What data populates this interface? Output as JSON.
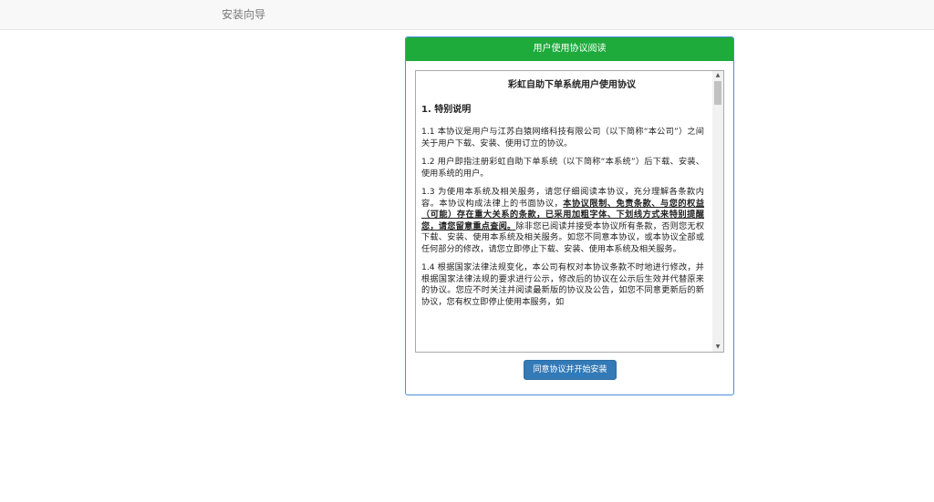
{
  "navbar": {
    "brand": "安装向导"
  },
  "panel": {
    "heading": "用户使用协议阅读",
    "install_button": "同意协议并开始安装"
  },
  "agreement": {
    "title": "彩虹自助下单系统用户使用协议",
    "section1_title": "1. 特别说明",
    "p1_1": "1.1 本协议是用户与江苏白猿网络科技有限公司（以下简称“本公司”）之间关于用户下载、安装、使用订立的协议。",
    "p1_2": "1.2 用户即指注册彩虹自助下单系统（以下简称“本系统”）后下载、安装、使用系统的用户。",
    "p1_3_a": "1.3 为使用本系统及相关服务，请您仔细阅读本协议，充分理解各条款内容。本协议构成法律上的书面协议，",
    "p1_3_b": "本协议限制、免责条款、与您的权益（可能）存在重大关系的条款，已采用加粗字体、下划线方式来特别提醒您，请您留意重点查阅。",
    "p1_3_c": "除非您已阅读并接受本协议所有条款，否则您无权下载、安装、使用本系统及相关服务。如您不同意本协议，或本协议全部或任何部分的修改，请您立即停止下载、安装、使用本系统及相关服务。",
    "p1_4": "1.4 根据国家法律法规变化，本公司有权对本协议条款不时地进行修改，并根据国家法律法规的要求进行公示，修改后的协议在公示后生效并代替原来的协议。您应不时关注并阅读最新版的协议及公告，如您不同意更新后的新协议，您有权立即停止使用本服务，如"
  },
  "icons": {
    "scroll_up": "scroll-up-arrow-icon",
    "scroll_down": "scroll-down-arrow-icon"
  },
  "colors": {
    "heading_bg": "#1faa3c",
    "panel_border": "#4a90d9",
    "button_bg": "#337ab7"
  }
}
